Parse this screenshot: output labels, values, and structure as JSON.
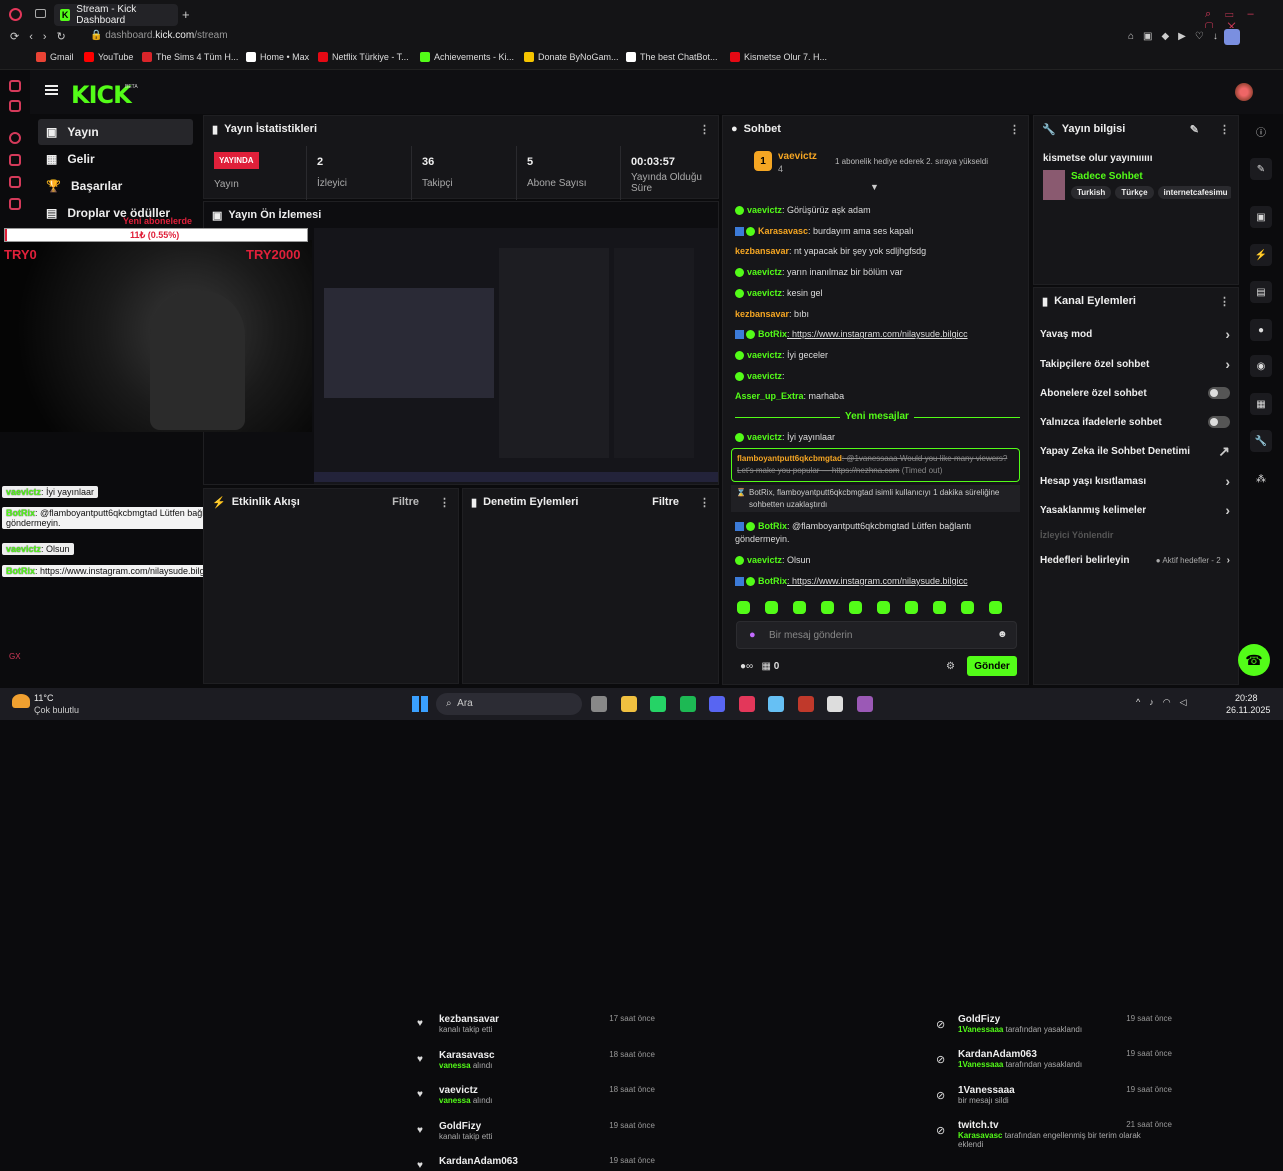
{
  "browser": {
    "tab_title": "Stream - Kick Dashboard",
    "url_prefix": "dashboard.",
    "url_domain": "kick.com",
    "url_path": "/stream",
    "bookmarks": [
      {
        "label": "Gmail",
        "color": "#ea4335"
      },
      {
        "label": "YouTube",
        "color": "#ff0000"
      },
      {
        "label": "The Sims 4 Tüm H...",
        "color": "#d9252a"
      },
      {
        "label": "Home • Max",
        "color": "#ffffff"
      },
      {
        "label": "Netflix Türkiye - T...",
        "color": "#e50914"
      },
      {
        "label": "Achievements - Ki...",
        "color": "#53fc18"
      },
      {
        "label": "Donate ByNoGam...",
        "color": "#f5c400"
      },
      {
        "label": "The best ChatBot...",
        "color": "#ffffff"
      },
      {
        "label": "Kismetse Olur 7. H...",
        "color": "#e50914"
      }
    ]
  },
  "brand": {
    "logo": "KICK",
    "beta": "BETA",
    "accent": "#53fc18"
  },
  "nav": {
    "items": [
      "Yayın",
      "Gelir",
      "Başarılar",
      "Droplar ve ödüller"
    ]
  },
  "stats": {
    "title": "Yayın İstatistikleri",
    "live_badge": "YAYINDA",
    "live_label": "Yayın",
    "viewers": "2",
    "viewers_label": "İzleyici",
    "followers": "36",
    "followers_label": "Takipçi",
    "subs": "5",
    "subs_label": "Abone Sayısı",
    "uptime": "00:03:57",
    "uptime_label": "Yayında Olduğu Süre"
  },
  "preview": {
    "title": "Yayın Ön İzlemesi"
  },
  "overlay": {
    "goal_label": "Yeni abonelerde",
    "goal_progress": "11₺ (0.55%)",
    "goal_fraction": 0.0055,
    "left_tag": "TRY0",
    "right_tag": "TRY2000",
    "chat": [
      {
        "user": "vaevictz",
        "text": ": İyi yayınlaar"
      },
      {
        "user": "BotRix",
        "text": ": @flamboyantputt6qkcbmgtad Lütfen bağlantı göndermeyin."
      },
      {
        "user": "vaevictz",
        "text": ": Olsun"
      },
      {
        "user": "BotRix",
        "text": ": https://www.instagram.com/nilaysude.bilgicc"
      }
    ]
  },
  "activity": {
    "title": "Etkinlik Akışı",
    "filter": "Filtre",
    "items": [
      {
        "name": "kezbansavar",
        "sub": "kanalı takip etti",
        "time": "17 saat önce"
      },
      {
        "name": "Karasavasc",
        "sub_hl": "vanessa",
        "sub": " alındı",
        "time": "18 saat önce"
      },
      {
        "name": "vaevictz",
        "sub_hl": "vanessa",
        "sub": " alındı",
        "time": "18 saat önce"
      },
      {
        "name": "GoldFizy",
        "sub": "kanalı takip etti",
        "time": "19 saat önce"
      },
      {
        "name": "KardanAdam063",
        "sub": "",
        "time": "19 saat önce"
      }
    ]
  },
  "moderation": {
    "title": "Denetim Eylemleri",
    "filter": "Filtre",
    "items": [
      {
        "name": "GoldFizy",
        "hl": "1Vanessaaa",
        "sub": " tarafından yasaklandı",
        "time": "19 saat önce"
      },
      {
        "name": "KardanAdam063",
        "hl": "1Vanessaaa",
        "sub": " tarafından yasaklandı",
        "time": "19 saat önce"
      },
      {
        "name": "1Vanessaaa",
        "hl": "",
        "sub": "bir mesajı sildi",
        "time": "19 saat önce"
      },
      {
        "name": "twitch.tv",
        "hl": "Karasavasc",
        "sub": " tarafından engellenmiş bir terim olarak eklendi",
        "time": "21 saat önce"
      }
    ]
  },
  "chat": {
    "title": "Sohbet",
    "pinned_user": "vaevictz",
    "pinned_count": "4",
    "pinned_rank": "1",
    "pinned_text": "1 abonelik hediye ederek 2. sıraya yükseldi",
    "messages": [
      {
        "user": "vaevictz",
        "text": ": Görüşürüz aşk adam",
        "style": "green"
      },
      {
        "user": "Karasavasc",
        "text": ": burdayım ama ses kapalı",
        "style": "orange"
      },
      {
        "user": "kezbansavar",
        "text": ": nt yapacak bir şey yok sdljhgfsdg",
        "style": "orange"
      },
      {
        "user": "vaevictz",
        "text": ": yarın inanılmaz bir bölüm var",
        "style": "green"
      },
      {
        "user": "vaevictz",
        "text": ": kesin gel",
        "style": "green"
      },
      {
        "user": "kezbansavar",
        "text": ": bıbı",
        "style": "orange"
      },
      {
        "user": "BotRix",
        "text": ": https://www.instagram.com/nilaysude.bilgicc",
        "style": "green"
      },
      {
        "user": "vaevictz",
        "text": ": İyi geceler",
        "style": "green"
      },
      {
        "user": "vaevictz",
        "text": ":",
        "style": "green"
      },
      {
        "user": "Asser_up_Extra",
        "text": ": marhaba",
        "style": "green"
      }
    ],
    "new_messages": "Yeni mesajlar",
    "after": [
      {
        "user": "vaevictz",
        "text": ": İyi yayınlaar"
      }
    ],
    "timed_out_user": "flamboyantputt6qkcbmgtad",
    "timed_out_text": ": @1vanessaaa Would you like many viewers? Let's make you popular — https://nezhna.com",
    "timed_out_tag": "(Timed out)",
    "mod_note": "BotRix, flamboyantputt6qkcbmgtad isimli kullanıcıyı 1 dakika süreliğine sohbetten uzaklaştırdı",
    "botrix_warn": ": @flamboyantputt6qkcbmgtad Lütfen bağlantı göndermeyin.",
    "olsun_user": "vaevictz",
    "olsun_text": ": Olsun",
    "last_user": "BotRix",
    "last_text": ": https://www.instagram.com/nilaysude.bilgicc",
    "input_placeholder": "Bir mesaj gönderin",
    "points": "0",
    "send": "Gönder"
  },
  "info": {
    "title": "Yayın bilgisi",
    "stream_title": "kismetse olur yayınıııııı",
    "chat_mode": "Sadece Sohbet",
    "tags": [
      "Turkish",
      "Türkçe",
      "internetcafesimu"
    ]
  },
  "channel": {
    "title": "Kanal Eylemleri",
    "items": [
      {
        "label": "Yavaş mod",
        "kind": "chevron"
      },
      {
        "label": "Takipçilere özel sohbet",
        "kind": "chevron"
      },
      {
        "label": "Abonelere özel sohbet",
        "kind": "toggle"
      },
      {
        "label": "Yalnızca ifadelerle sohbet",
        "kind": "toggle"
      },
      {
        "label": "Yapay Zeka ile Sohbet Denetimi",
        "kind": "ext"
      },
      {
        "label": "Hesap yaşı kısıtlaması",
        "kind": "chevron"
      },
      {
        "label": "Yasaklanmış kelimeler",
        "kind": "chevron"
      }
    ],
    "section": "İzleyici Yönlendir",
    "goals_label": "Hedefleri belirleyin",
    "goals_status": "Aktif hedefler - 2"
  },
  "taskbar": {
    "temp": "11°C",
    "weather": "Çok bulutlu",
    "search": "Ara",
    "time": "20:28",
    "date": "26.11.2025"
  }
}
